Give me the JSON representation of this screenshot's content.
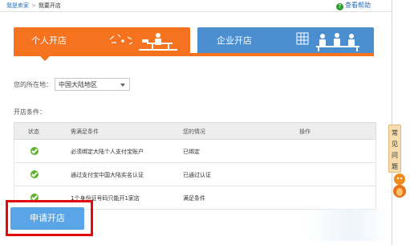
{
  "breadcrumb": {
    "root": "我是卖家",
    "separator": ">",
    "current": "我要开店"
  },
  "help": {
    "label": "查看帮助"
  },
  "tabs": [
    {
      "label": "个人开店",
      "active": true,
      "color": "#f5731f"
    },
    {
      "label": "企业开店",
      "active": false,
      "color": "#4a8ed0"
    }
  ],
  "location": {
    "label": "您的所在地：",
    "selected": "中国大陆地区"
  },
  "conditions": {
    "label": "开店条件：",
    "headers": [
      "状态",
      "需满足条件",
      "您的情况",
      "操作"
    ],
    "rows": [
      {
        "condition": "必须绑定大陆个人支付宝账户",
        "status": "已绑定"
      },
      {
        "condition": "通过支付宝中国大陆实名认证",
        "status": "已通过认证"
      },
      {
        "condition": "1个身份证号码只能开1家店",
        "status": "满足条件"
      }
    ]
  },
  "apply_button": {
    "label": "申请开店"
  },
  "side_faq": {
    "chars": [
      "常",
      "见",
      "问",
      "题"
    ]
  },
  "colors": {
    "accent_orange": "#f5731f",
    "accent_blue": "#4a8ed0",
    "button_blue": "#5aa5e8",
    "highlight_red": "#e20a0a",
    "check_green": "#5db22b"
  }
}
